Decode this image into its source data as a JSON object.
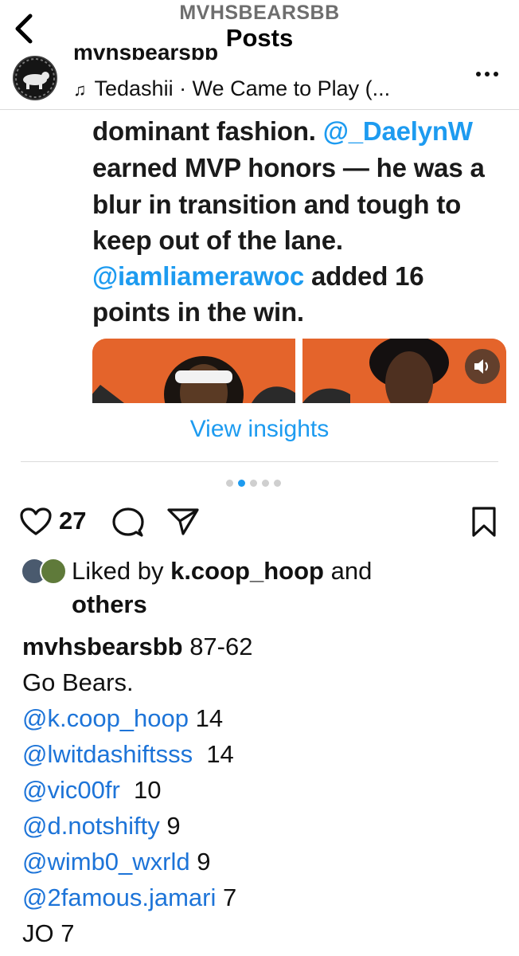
{
  "nav": {
    "subtitle": "MVHSBEARSBB",
    "title": "Posts"
  },
  "post": {
    "username": "mvhsbearsbb",
    "audio": "Tedashii · We Came to Play (..."
  },
  "media": {
    "tweet_lines": [
      {
        "parts": [
          {
            "text": "dominant fashion. ",
            "type": "text"
          },
          {
            "text": "@_DaelynW",
            "type": "mention"
          }
        ]
      },
      {
        "parts": [
          {
            "text": "earned MVP honors — he was a",
            "type": "text"
          }
        ]
      },
      {
        "parts": [
          {
            "text": "blur in transition and tough to",
            "type": "text"
          }
        ]
      },
      {
        "parts": [
          {
            "text": "keep out of the lane.",
            "type": "text"
          }
        ]
      },
      {
        "parts": [
          {
            "text": "@iamliamerawoc",
            "type": "mention"
          },
          {
            "text": " added 16",
            "type": "text"
          }
        ]
      },
      {
        "parts": [
          {
            "text": "points in the win.",
            "type": "text"
          }
        ]
      }
    ],
    "carousel_total": 5,
    "carousel_index": 2
  },
  "insights": {
    "label": "View insights"
  },
  "actions": {
    "like_count": "27"
  },
  "likes": {
    "prefix": "Liked by ",
    "user": "k.coop_hoop",
    "and": " and",
    "others": "others"
  },
  "caption": {
    "username": "mvhsbearsbb",
    "score": " 87-62",
    "line2": "Go Bears.",
    "credits": [
      {
        "handle": "@k.coop_hoop",
        "points": " 14"
      },
      {
        "handle": "@lwitdashiftsss",
        "points": "  14"
      },
      {
        "handle": "@vic00fr",
        "points": "  10"
      },
      {
        "handle": "@d.notshifty",
        "points": " 9"
      },
      {
        "handle": "@wimb0_wxrld",
        "points": " 9"
      },
      {
        "handle": "@2famous.jamari",
        "points": " 7"
      }
    ],
    "last_line": "JO 7"
  },
  "colors": {
    "link": "#1d9bf0",
    "mention": "#1d74d8",
    "media_bg": "#e4642b",
    "divider": "#dbdbdb",
    "active_dot": "#1d9bf0"
  },
  "icons": [
    "back-chevron-icon",
    "more-icon",
    "music-note-icon",
    "heart-icon",
    "comment-icon",
    "share-icon",
    "bookmark-icon",
    "sound-icon"
  ]
}
